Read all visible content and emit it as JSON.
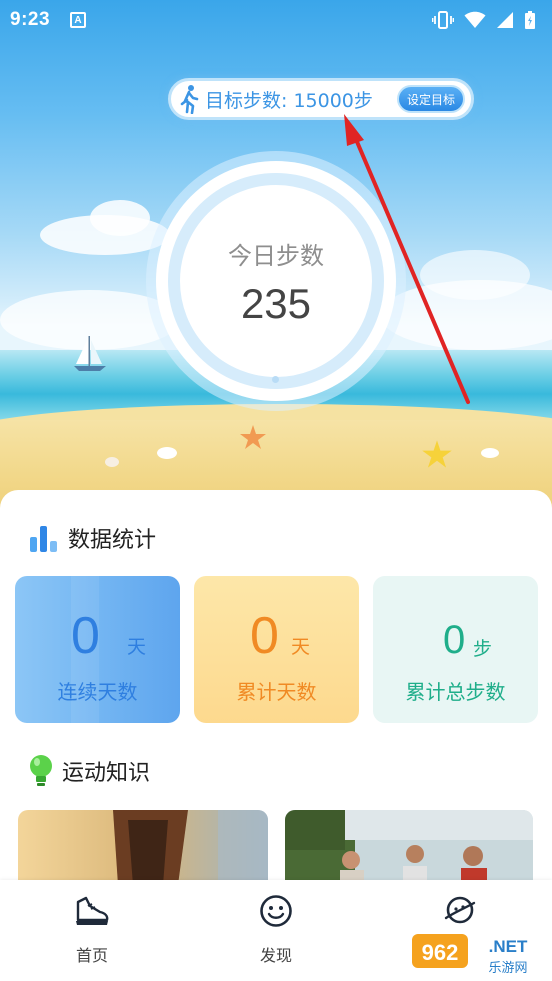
{
  "status_bar": {
    "time": "9:23",
    "indicator": "A"
  },
  "goal": {
    "text": "目标步数: 15000步",
    "button": "设定目标"
  },
  "today": {
    "label": "今日步数",
    "steps": "235"
  },
  "stats": {
    "title": "数据统计",
    "cards": [
      {
        "value": "0",
        "unit": "天",
        "label": "连续天数",
        "color": "#2f7fe0"
      },
      {
        "value": "0",
        "unit": "天",
        "label": "累计天数",
        "color": "#f08a24"
      },
      {
        "value": "0",
        "unit": "步",
        "label": "累计总步数",
        "color": "#1fae8a"
      }
    ]
  },
  "knowledge": {
    "title": "运动知识"
  },
  "nav": {
    "items": [
      "首页",
      "发现",
      ""
    ]
  },
  "watermark": {
    "text": "962.NET",
    "subtext": "乐游网"
  },
  "colors": {
    "accent": "#3c95e4",
    "orange": "#f08a24",
    "teal": "#1fae8a"
  }
}
